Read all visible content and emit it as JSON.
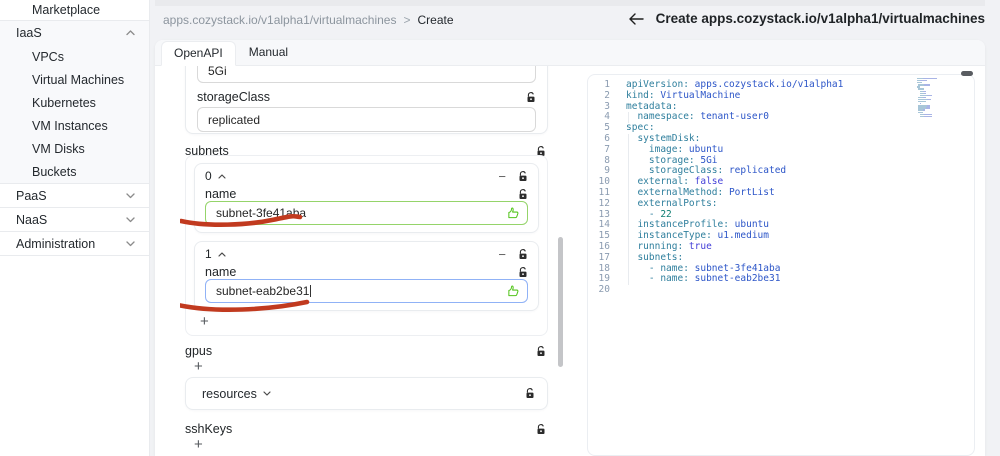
{
  "app": {
    "breadcrumb": {
      "path": "apps.cozystack.io/v1alpha1/virtualmachines",
      "separator": ">",
      "current": "Create"
    },
    "header": {
      "title": "Create apps.cozystack.io/v1alpha1/virtualmachines"
    }
  },
  "sidebar": {
    "items": [
      {
        "label": "Marketplace"
      },
      {
        "label": "IaaS"
      },
      {
        "label": "VPCs"
      },
      {
        "label": "Virtual Machines"
      },
      {
        "label": "Kubernetes"
      },
      {
        "label": "VM Instances"
      },
      {
        "label": "VM Disks"
      },
      {
        "label": "Buckets"
      },
      {
        "label": "PaaS"
      },
      {
        "label": "NaaS"
      },
      {
        "label": "Administration"
      }
    ]
  },
  "tabs": {
    "openapi": "OpenAPI",
    "manual": "Manual"
  },
  "form": {
    "storage_input_value": "5Gi",
    "storage_class_label": "storageClass",
    "storage_class_value": "replicated",
    "subnets_label": "subnets",
    "add_button": "+",
    "remove_button": "−",
    "subnet_items": [
      {
        "index": "0",
        "field_label": "name",
        "value": "subnet-3fe41aba"
      },
      {
        "index": "1",
        "field_label": "name",
        "value": "subnet-eab2be31"
      }
    ],
    "gpus_label": "gpus",
    "resources_label": "resources",
    "sshkeys_label": "sshKeys"
  },
  "editor": {
    "lines": [
      {
        "num": "1",
        "key": "apiVersion:",
        "value": " apps.cozystack.io/v1alpha1",
        "vclass": "tok-str"
      },
      {
        "num": "2",
        "key": "kind:",
        "value": " VirtualMachine",
        "vclass": "tok-str"
      },
      {
        "num": "3",
        "key": "metadata:",
        "value": "",
        "vclass": ""
      },
      {
        "num": "4",
        "key": "  namespace:",
        "value": " tenant-user0",
        "vclass": "tok-str"
      },
      {
        "num": "5",
        "key": "spec:",
        "value": "",
        "vclass": ""
      },
      {
        "num": "6",
        "key": "  systemDisk:",
        "value": "",
        "vclass": ""
      },
      {
        "num": "7",
        "key": "    image:",
        "value": " ubuntu",
        "vclass": "tok-str"
      },
      {
        "num": "8",
        "key": "    storage:",
        "value": " 5Gi",
        "vclass": "tok-str"
      },
      {
        "num": "9",
        "key": "    storageClass:",
        "value": " replicated",
        "vclass": "tok-str"
      },
      {
        "num": "10",
        "key": "  external:",
        "value": " false",
        "vclass": "tok-bool"
      },
      {
        "num": "11",
        "key": "  externalMethod:",
        "value": " PortList",
        "vclass": "tok-str"
      },
      {
        "num": "12",
        "key": "  externalPorts:",
        "value": "",
        "vclass": ""
      },
      {
        "num": "13",
        "key": "    -",
        "value": " 22",
        "vclass": "tok-num"
      },
      {
        "num": "14",
        "key": "  instanceProfile:",
        "value": " ubuntu",
        "vclass": "tok-str"
      },
      {
        "num": "15",
        "key": "  instanceType:",
        "value": " u1.medium",
        "vclass": "tok-str"
      },
      {
        "num": "16",
        "key": "  running:",
        "value": " true",
        "vclass": "tok-bool"
      },
      {
        "num": "17",
        "key": "  subnets:",
        "value": "",
        "vclass": ""
      },
      {
        "num": "18",
        "key": "    - name:",
        "value": " subnet-3fe41aba",
        "vclass": "tok-str"
      },
      {
        "num": "19",
        "key": "    - name:",
        "value": " subnet-eab2be31",
        "vclass": "tok-str"
      },
      {
        "num": "20",
        "key": "",
        "value": "",
        "vclass": ""
      }
    ]
  },
  "colors": {
    "annotation_red": "#c13a1f",
    "input_valid_border": "#95d46a",
    "input_focus_border": "#90b2f6",
    "thumbs_up_green": "#52c41a",
    "yaml_key": "#2f7f9d",
    "yaml_string": "#2d56c8",
    "yaml_bool": "#4440d8",
    "yaml_number": "#0c7d72"
  }
}
